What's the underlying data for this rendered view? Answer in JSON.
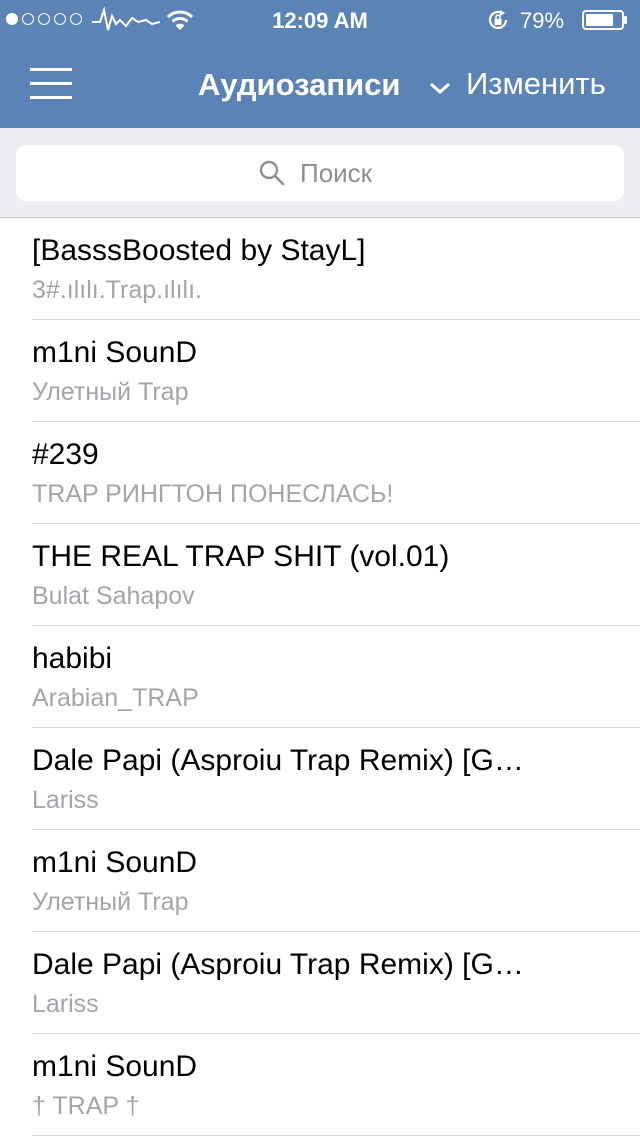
{
  "status_bar": {
    "signal_bars_filled": 1,
    "signal_bars_total": 5,
    "time": "12:09 AM",
    "battery_percent": "79%"
  },
  "navbar": {
    "title": "Аудиозаписи",
    "edit_label": "Изменить",
    "menu_icon": "hamburger-icon",
    "dropdown_icon": "chevron-down-icon"
  },
  "search": {
    "placeholder": "Поиск",
    "icon": "search-icon"
  },
  "colors": {
    "header_bg": "#5b83b6",
    "search_area_bg": "#eceef2",
    "subtitle_text": "#a2a5aa"
  },
  "tracks": [
    {
      "title": "[BasssBoosted by StayL]",
      "artist": "3#.ılılı.Trap.ılılı."
    },
    {
      "title": "m1ni SounD",
      "artist": "Улетный Trap"
    },
    {
      "title": "#239",
      "artist": "TRAP РИНГТОН ПОНЕСЛАСЬ!"
    },
    {
      "title": "THE REAL TRAP SHIT (vol.01)",
      "artist": "Bulat Sahapov"
    },
    {
      "title": "habibi",
      "artist": "Arabian_TRAP"
    },
    {
      "title": "Dale Papi (Asproiu Trap Remix) [G…",
      "artist": "Lariss"
    },
    {
      "title": "m1ni SounD",
      "artist": "Улетный Trap"
    },
    {
      "title": "Dale Papi (Asproiu Trap Remix) [G…",
      "artist": "Lariss"
    },
    {
      "title": "m1ni SounD",
      "artist": "† TRAP †"
    }
  ]
}
